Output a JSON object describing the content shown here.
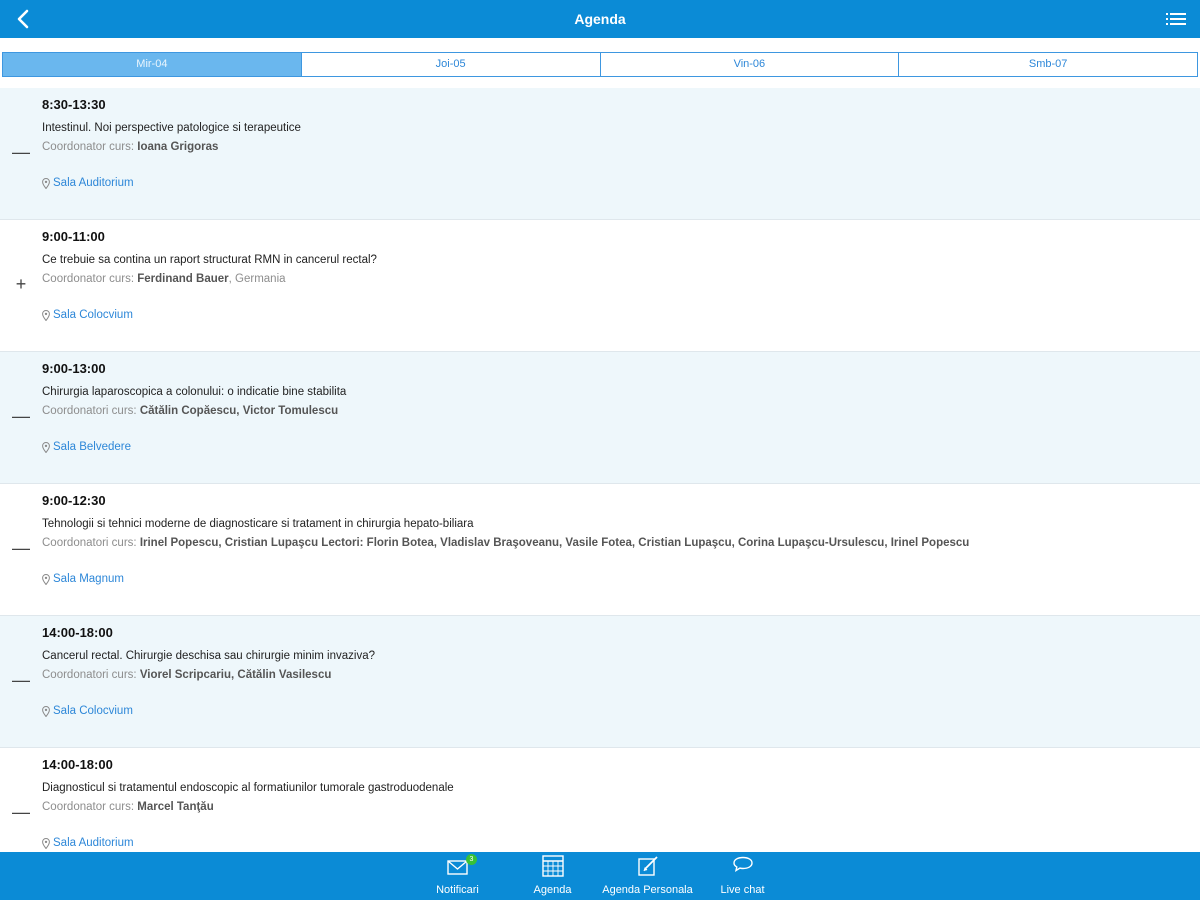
{
  "header": {
    "title": "Agenda"
  },
  "tabs": [
    {
      "label": "Mir-04"
    },
    {
      "label": "Joi-05"
    },
    {
      "label": "Vin-06"
    },
    {
      "label": "Smb-07"
    }
  ],
  "sessions": [
    {
      "toggle": "—",
      "time": "8:30-13:30",
      "title": "Intestinul. Noi perspective patologice si terapeutice",
      "coord_label": "Coordonator curs:",
      "coord_names": "Ioana Grigoras",
      "coord_extra": "",
      "room": "Sala Auditorium"
    },
    {
      "toggle": "+",
      "time": "9:00-11:00",
      "title": "Ce trebuie sa contina un raport structurat RMN in cancerul rectal?",
      "coord_label": "Coordonator curs:",
      "coord_names": "Ferdinand Bauer",
      "coord_extra": ", Germania",
      "room": "Sala Colocvium"
    },
    {
      "toggle": "—",
      "time": "9:00-13:00",
      "title": "Chirurgia laparoscopica a colonului: o indicatie bine stabilita",
      "coord_label": "Coordonatori curs:",
      "coord_names": "Cătălin Copăescu, Victor Tomulescu",
      "coord_extra": "",
      "room": "Sala Belvedere"
    },
    {
      "toggle": "—",
      "time": "9:00-12:30",
      "title": "Tehnologii si tehnici moderne de diagnosticare si tratament in chirurgia hepato-biliara",
      "coord_label": "Coordonatori curs:",
      "coord_names": "Irinel Popescu, Cristian Lupaşcu Lectori: Florin Botea, Vladislav Braşoveanu, Vasile Fotea, Cristian Lupaşcu, Corina Lupaşcu-Ursulescu, Irinel Popescu",
      "coord_extra": "",
      "room": "Sala Magnum"
    },
    {
      "toggle": "—",
      "time": "14:00-18:00",
      "title": "Cancerul rectal. Chirurgie deschisa sau chirurgie minim invaziva?",
      "coord_label": "Coordonatori curs:",
      "coord_names": "Viorel Scripcariu, Cătălin Vasilescu",
      "coord_extra": "",
      "room": "Sala Colocvium"
    },
    {
      "toggle": "—",
      "time": "14:00-18:00",
      "title": "Diagnosticul si tratamentul endoscopic al formatiunilor tumorale gastroduodenale",
      "coord_label": "Coordonator curs:",
      "coord_names": "Marcel Tanţău",
      "coord_extra": "",
      "room": "Sala Auditorium"
    }
  ],
  "bottom_nav": [
    {
      "label": "Notificari",
      "icon": "mail-icon",
      "badge": "3"
    },
    {
      "label": "Agenda",
      "icon": "calendar-icon"
    },
    {
      "label": "Agenda Personala",
      "icon": "edit-icon"
    },
    {
      "label": "Live chat",
      "icon": "chat-icon"
    }
  ],
  "colors": {
    "primary": "#0b8bd6",
    "tab_active": "#6ab7ee",
    "link": "#2d87d8",
    "row_shaded": "#eef7fb",
    "badge": "#37c137"
  }
}
